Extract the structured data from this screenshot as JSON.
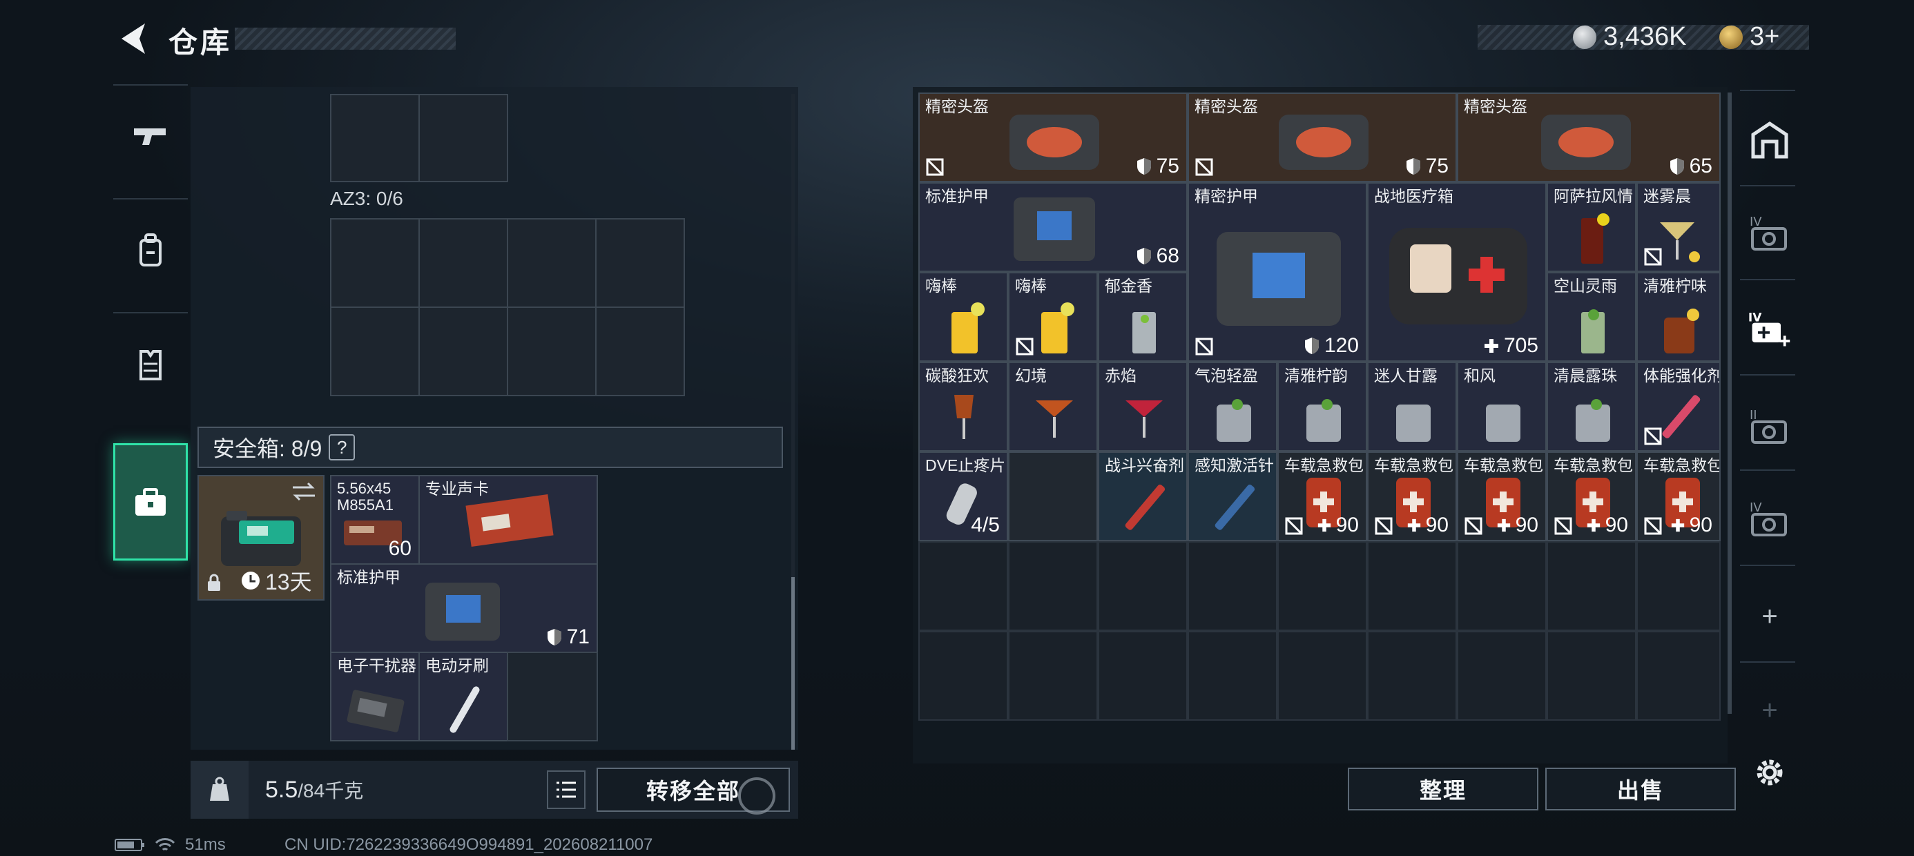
{
  "header": {
    "title": "仓库",
    "currency": "3,436K",
    "tickets": "3+"
  },
  "left_sidebar": [
    {
      "icon": "gun-icon"
    },
    {
      "icon": "backpack-icon"
    },
    {
      "icon": "vest-icon"
    },
    {
      "icon": "safebox-icon"
    }
  ],
  "stash": {
    "az3_label": "AZ3: 0/6",
    "safebox_label": "安全箱: 8/9",
    "safebox_help": "?",
    "safebox_timer": "13天",
    "items": [
      {
        "name": "5.56x45\nM855A1",
        "value": "60"
      },
      {
        "name": "专业声卡",
        "value": ""
      },
      {
        "name": "标准护甲",
        "value": "71"
      },
      {
        "name": "电子干扰器",
        "value": ""
      },
      {
        "name": "电动牙刷",
        "value": ""
      }
    ],
    "weight": "5.5",
    "weight_max": "/84千克",
    "transfer_all": "转移全部"
  },
  "grid_items": [
    {
      "name": "精密头盔",
      "value": "75"
    },
    {
      "name": "精密头盔",
      "value": "75"
    },
    {
      "name": "精密头盔",
      "value": "65"
    },
    {
      "name": "标准护甲",
      "value": "68"
    },
    {
      "name": "精密护甲",
      "value": "120"
    },
    {
      "name": "战地医疗箱",
      "value": "705"
    },
    {
      "name": "阿萨拉风情",
      "value": ""
    },
    {
      "name": "迷雾晨",
      "value": ""
    },
    {
      "name": "嗨棒",
      "value": ""
    },
    {
      "name": "嗨棒",
      "value": ""
    },
    {
      "name": "郁金香",
      "value": ""
    },
    {
      "name": "空山灵雨",
      "value": ""
    },
    {
      "name": "清雅柠味",
      "value": ""
    },
    {
      "name": "碳酸狂欢",
      "value": ""
    },
    {
      "name": "幻境",
      "value": ""
    },
    {
      "name": "赤焰",
      "value": ""
    },
    {
      "name": "气泡轻盈",
      "value": ""
    },
    {
      "name": "清雅柠韵",
      "value": ""
    },
    {
      "name": "迷人甘露",
      "value": ""
    },
    {
      "name": "和风",
      "value": ""
    },
    {
      "name": "清晨露珠",
      "value": ""
    },
    {
      "name": "体能强化剂",
      "value": ""
    },
    {
      "name": "DVE止疼片",
      "value": "4/5"
    },
    {
      "name": "战斗兴奋剂",
      "value": ""
    },
    {
      "name": "感知激活针",
      "value": ""
    },
    {
      "name": "车载急救包",
      "value": "90"
    },
    {
      "name": "车载急救包",
      "value": "90"
    },
    {
      "name": "车载急救包",
      "value": "90"
    },
    {
      "name": "车载急救包",
      "value": "90"
    },
    {
      "name": "车载急救包",
      "value": "90"
    }
  ],
  "buttons": {
    "organize": "整理",
    "sell": "出售"
  },
  "right_sidebar": [
    {
      "icon": "storage-tab-icon"
    },
    {
      "icon": "tier-iv-camera-icon"
    },
    {
      "icon": "tier-iv-medkit-add-icon"
    },
    {
      "icon": "tier-ii-camera-icon"
    },
    {
      "icon": "tier-iv-camera-icon-2"
    },
    {
      "icon": "plus-icon"
    },
    {
      "icon": "plus-icon-dim"
    },
    {
      "icon": "gear-icon"
    }
  ],
  "footer": {
    "ping": "51ms",
    "uid": "CN UID:7262239336649O994891_202608211007"
  },
  "colors": {
    "accent": "#2fe3a8",
    "brown_bg": "#3a2d25",
    "navy_bg": "#252a3d"
  }
}
